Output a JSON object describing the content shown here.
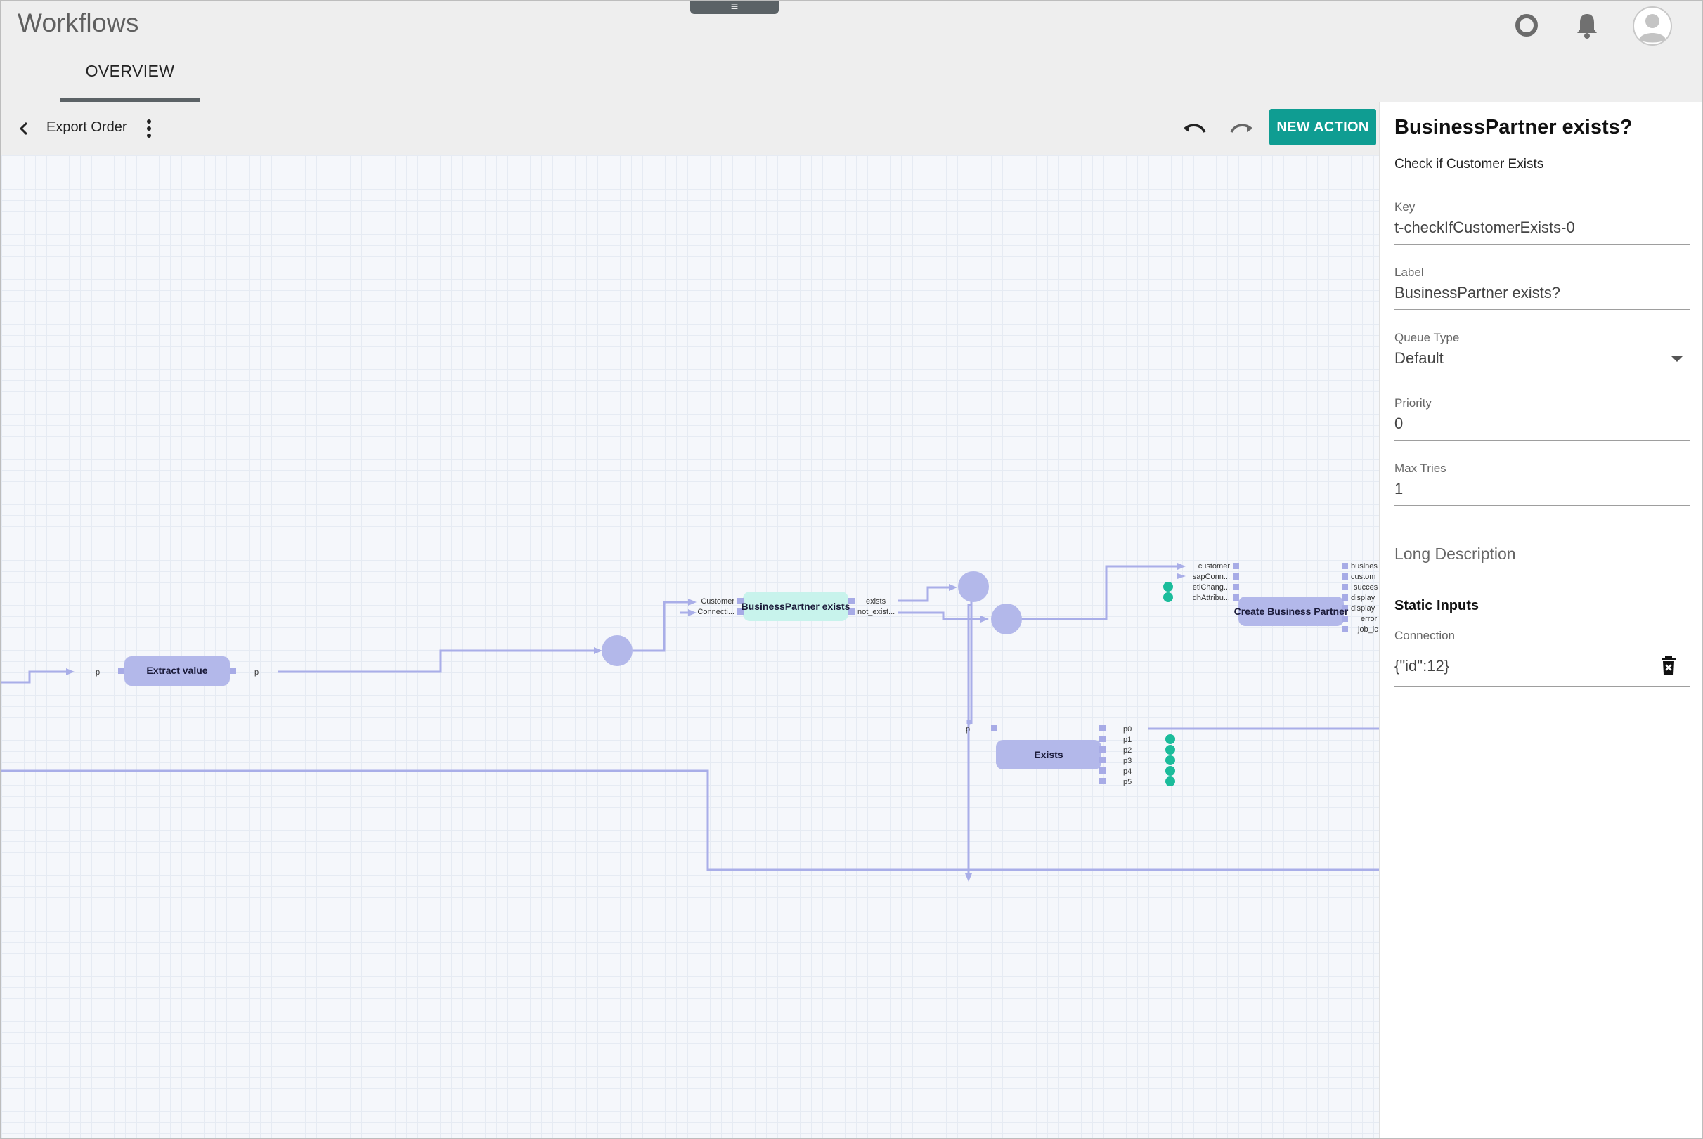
{
  "app": {
    "title": "Workflows",
    "drawer_handle": "≡"
  },
  "header_icons": {
    "status": "circle-status-icon",
    "notifications": "bell-icon",
    "account": "avatar-icon"
  },
  "tabs": [
    {
      "label": "OVERVIEW",
      "active": true
    }
  ],
  "toolbar": {
    "workflow_name": "Export Order",
    "new_action_label": "NEW ACTION"
  },
  "colors": {
    "accent": "#0f9d92",
    "node": "#b3b8ea",
    "node_selected": "#c8f3ec",
    "edge": "#a9aee8",
    "port": "#a7abe6",
    "add_port": "#1bbc9b"
  },
  "canvas": {
    "nodes": [
      {
        "label": "Extract value",
        "inputs": [
          "p"
        ],
        "outputs": [
          "p"
        ]
      },
      {
        "label": "BusinessPartner exists",
        "selected": true,
        "inputs": [
          "Customer",
          "Connecti..."
        ],
        "outputs": [
          "exists",
          "not_exist..."
        ]
      },
      {
        "label": "Exists",
        "inputs": [
          "p"
        ],
        "outputs": [
          "p0",
          "p1",
          "p2",
          "p3",
          "p4",
          "p5"
        ]
      },
      {
        "label": "Create Business Partner",
        "inputs": [
          "customer",
          "sapConn...",
          "etlChang...",
          "dhAttribu..."
        ],
        "outputs": [
          "busines",
          "custom",
          "succes",
          "display",
          "display",
          "error",
          "job_ic"
        ]
      }
    ]
  },
  "panel": {
    "title": "BusinessPartner exists?",
    "subtitle": "Check if Customer Exists",
    "fields": {
      "key": {
        "label": "Key",
        "value": "t-checkIfCustomerExists-0"
      },
      "label": {
        "label": "Label",
        "value": "BusinessPartner exists?"
      },
      "queue_type": {
        "label": "Queue Type",
        "value": "Default"
      },
      "priority": {
        "label": "Priority",
        "value": "0"
      },
      "max_tries": {
        "label": "Max Tries",
        "value": "1"
      },
      "long_description": {
        "placeholder": "Long Description"
      }
    },
    "static_inputs": {
      "title": "Static Inputs",
      "connection": {
        "label": "Connection",
        "value": "{\"id\":12}"
      }
    }
  }
}
